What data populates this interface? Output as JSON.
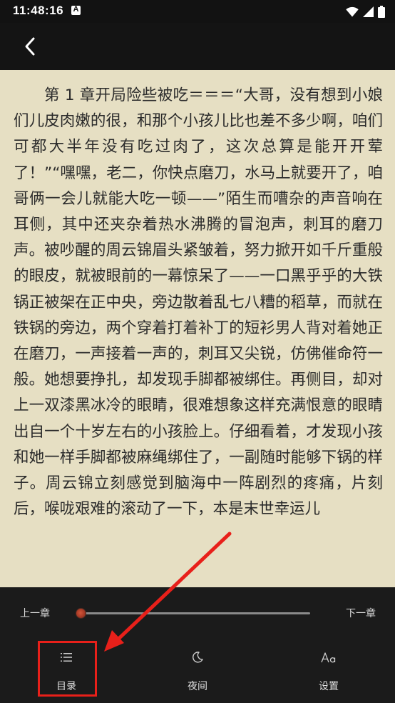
{
  "status_bar": {
    "time": "11:48:16",
    "notification_icon": "A"
  },
  "top_bar": {
    "back_icon": "chevron-left-icon"
  },
  "reader": {
    "text": "第 1 章开局险些被吃＝＝＝“大哥，没有想到小娘们儿皮肉嫩的很，和那个小孩儿比也差不多少啊，咱们可都大半年没有吃过肉了，这次总算是能开开荤了！”“嘿嘿，老二，你快点磨刀，水马上就要开了，咱哥俩一会儿就能大吃一顿——”陌生而嘈杂的声音响在耳侧，其中还夹杂着热水沸腾的冒泡声，刺耳的磨刀声。被吵醒的周云锦眉头紧皱着，努力掀开如千斤重般的眼皮，就被眼前的一幕惊呆了——一口黑乎乎的大铁锅正被架在正中央，旁边散着乱七八糟的稻草，而就在铁锅的旁边，两个穿着打着补丁的短衫男人背对着她正在磨刀，一声接着一声的，刺耳又尖锐，仿佛催命符一般。她想要挣扎，却发现手脚都被绑住。再侧目，却对上一双漆黑冰冷的眼睛，很难想象这样充满恨意的眼睛出自一个十岁左右的小孩脸上。仔细看着，才发现小孩和她一样手脚都被麻绳绑住了，一副随时能够下锅的样子。周云锦立刻感觉到脑海中一阵剧烈的疼痛，片刻后，喉咙艰难的滚动了一下，本是末世幸运儿",
    "background_color": "#e6dfc3"
  },
  "controls": {
    "prev_chapter": "上一章",
    "next_chapter": "下一章",
    "progress": 0.0,
    "menu": {
      "toc_label": "目录",
      "toc_icon": "list-icon",
      "night_label": "夜间",
      "night_icon": "moon-icon",
      "settings_label": "设置",
      "settings_icon": "font-size-icon"
    }
  },
  "annotation": {
    "color": "#e8201a",
    "target": "目录"
  }
}
